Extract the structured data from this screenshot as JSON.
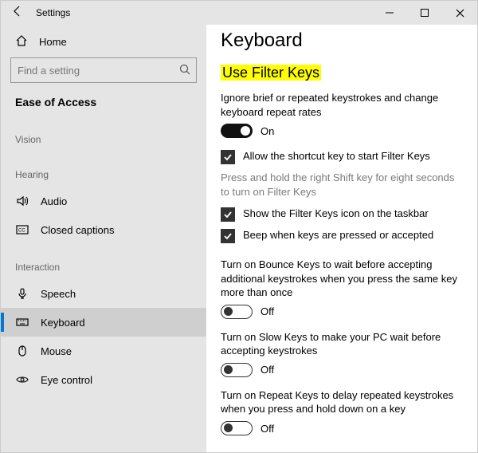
{
  "titlebar": {
    "title": "Settings"
  },
  "sidebar": {
    "home": "Home",
    "search_placeholder": "Find a setting",
    "category": "Ease of Access",
    "sections": {
      "vision": "Vision",
      "hearing": "Hearing",
      "interaction": "Interaction"
    },
    "items": {
      "audio": "Audio",
      "closed_captions": "Closed captions",
      "speech": "Speech",
      "keyboard": "Keyboard",
      "mouse": "Mouse",
      "eye_control": "Eye control"
    }
  },
  "main": {
    "title": "Keyboard",
    "filter_keys": {
      "heading": "Use Filter Keys",
      "desc": "Ignore brief or repeated keystrokes and change keyboard repeat rates",
      "toggle_state": "On",
      "shortcut_checkbox": "Allow the shortcut key to start Filter Keys",
      "shortcut_help": "Press and hold the right Shift key for eight seconds to turn on Filter Keys",
      "taskbar_checkbox": "Show the Filter Keys icon on the taskbar",
      "beep_checkbox": "Beep when keys are pressed or accepted",
      "bounce": {
        "desc": "Turn on Bounce Keys to wait before accepting additional keystrokes when you press the same key more than once",
        "state": "Off"
      },
      "slow": {
        "desc": "Turn on Slow Keys to make your PC wait before accepting keystrokes",
        "state": "Off"
      },
      "repeat": {
        "desc": "Turn on Repeat Keys to delay repeated keystrokes when you press and hold down on a key",
        "state": "Off"
      }
    }
  }
}
